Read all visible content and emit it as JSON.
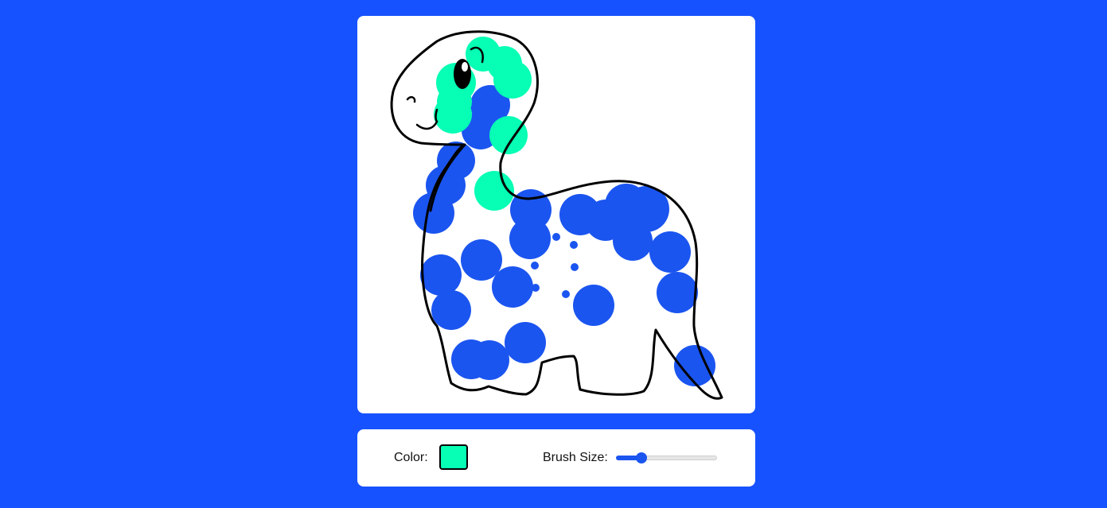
{
  "colors": {
    "background": "#1652ff",
    "blue_paint": "#1b55f0",
    "green_paint": "#06ffb4",
    "outline": "#000000",
    "slider_accent": "#1b55f0"
  },
  "canvas": {
    "subject": "dinosaur-coloring-page"
  },
  "controls": {
    "color_label": "Color:",
    "selected_color": "#06ffb4",
    "brush_label": "Brush Size:",
    "brush_size_fraction": 0.25
  }
}
